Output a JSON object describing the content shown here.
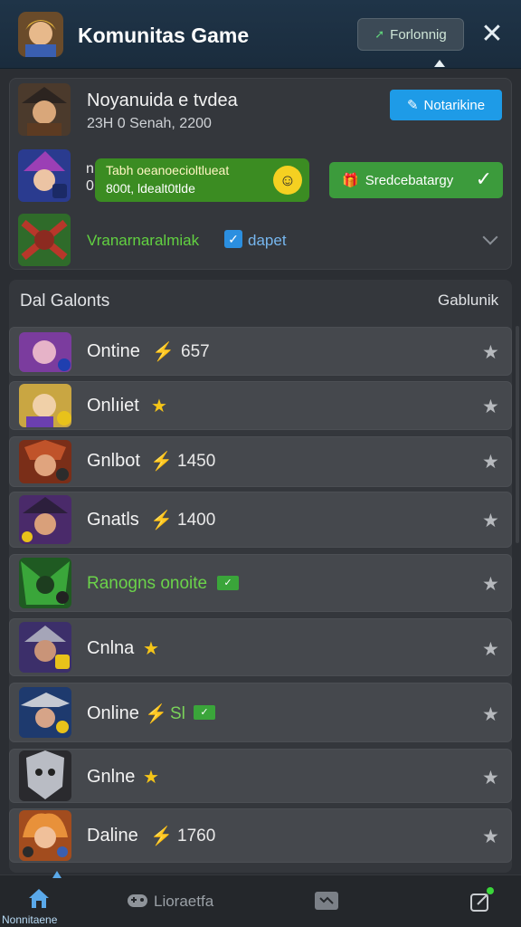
{
  "header": {
    "title": "Komunitas Game",
    "button_label": "Forlonnig",
    "close_icon": "close-icon"
  },
  "notification": {
    "title": "Noyanuida e tvdea",
    "subtitle": "23H 0 Senah, 2200",
    "blue_button_label": "Notarikine"
  },
  "promo": {
    "left_fragment_top": "n",
    "left_fragment_bottom": "0",
    "tip_line1": "Tabh oeanoecioltlueat",
    "tip_line2": "800t, ldealt0tlde",
    "green_button_label": "Sredcebatargy"
  },
  "gaming": {
    "label": "Vranarnaralmiak",
    "tag": "dapet"
  },
  "list": {
    "header_left": "Dal Galonts",
    "header_right": "Gablunik",
    "rows": [
      {
        "label": "Ontine",
        "number": "657"
      },
      {
        "label": "Onlıiet",
        "number": ""
      },
      {
        "label": "Gnlbot",
        "number": "1450"
      },
      {
        "label": "Gnatls",
        "number": "1400"
      },
      {
        "label": "Ranogns onoite",
        "number": ""
      },
      {
        "label": "Cnlna",
        "number": ""
      },
      {
        "label": "Online",
        "number": "Sl"
      },
      {
        "label": "Gnlne",
        "number": ""
      },
      {
        "label": "Daline",
        "number": "1760"
      }
    ]
  },
  "bottom_nav": {
    "home_label": "Nonnitaene",
    "middle_label": "Lioraetfa"
  },
  "colors": {
    "background": "#2b2e33",
    "header": "#1f3448",
    "accent_blue": "#1e9be7",
    "accent_green": "#3c9b3c",
    "gold": "#f5c518"
  }
}
